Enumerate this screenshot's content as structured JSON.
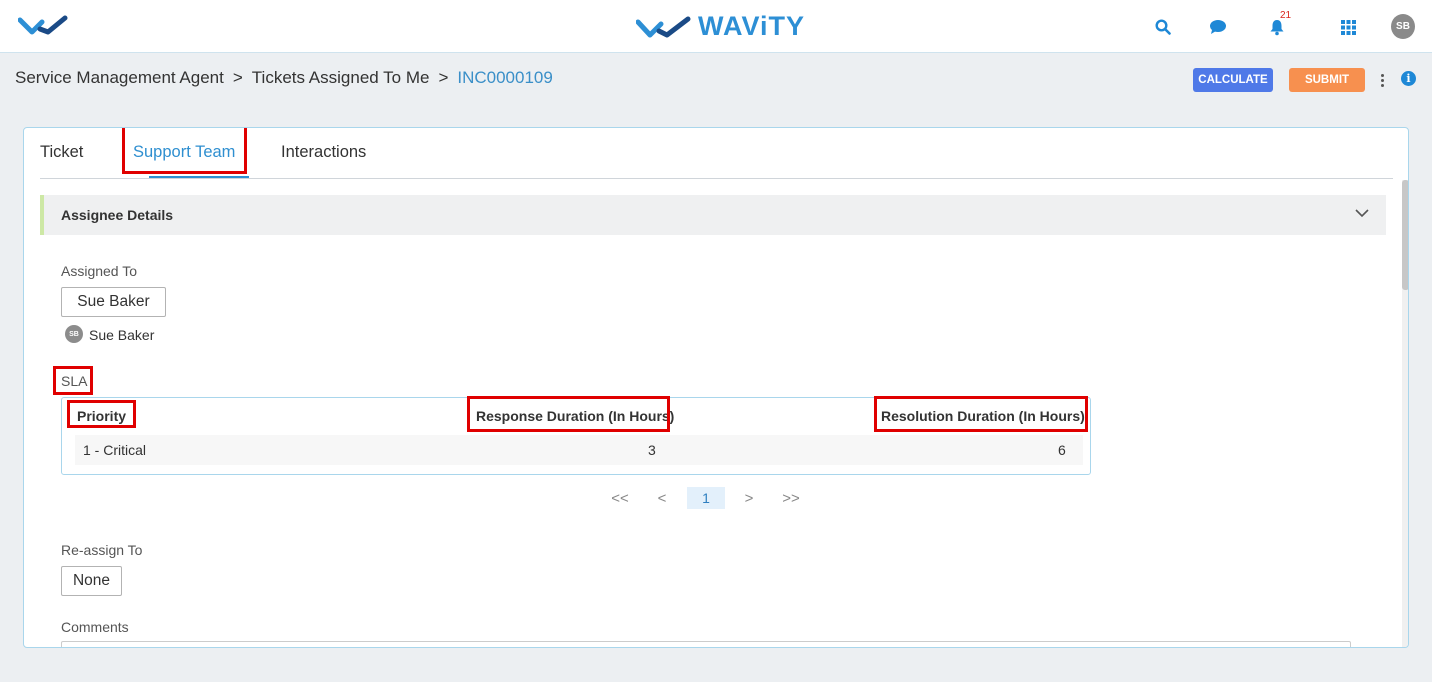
{
  "header": {
    "brand_name": "WAViTY",
    "notification_count": "21",
    "user_initials": "SB",
    "icons": [
      "logo-icon",
      "search-icon",
      "chat-icon",
      "bell-icon",
      "apps-grid-icon"
    ]
  },
  "breadcrumb": {
    "items": [
      "Service Management Agent",
      "Tickets Assigned To Me"
    ],
    "separator": ">",
    "current": "INC0000109"
  },
  "toolbar": {
    "calculate_label": "CALCULATE",
    "submit_label": "SUBMIT",
    "info_glyph": "i"
  },
  "tabs": [
    {
      "label": "Ticket"
    },
    {
      "label": "Support Team"
    },
    {
      "label": "Interactions"
    }
  ],
  "section": {
    "title": "Assignee Details"
  },
  "assignee": {
    "label": "Assigned To",
    "value": "Sue Baker",
    "user_initials": "SB",
    "user_name": "Sue Baker"
  },
  "sla": {
    "label": "SLA",
    "columns": [
      "Priority",
      "Response Duration (In Hours)",
      "Resolution Duration (In Hours)"
    ],
    "rows": [
      {
        "priority": "1 - Critical",
        "response": "3",
        "resolution": "6"
      }
    ]
  },
  "pagination": {
    "first": "<<",
    "prev": "<",
    "current": "1",
    "next": ">",
    "last": ">>"
  },
  "reassign": {
    "label": "Re-assign To",
    "value": "None"
  },
  "comments": {
    "label": "Comments"
  },
  "colors": {
    "accent_blue": "#2f8fd0",
    "calculate_button": "#4f79e8",
    "submit_button": "#f7904f",
    "highlight": "#e00000",
    "section_accent": "#cde8a5"
  }
}
